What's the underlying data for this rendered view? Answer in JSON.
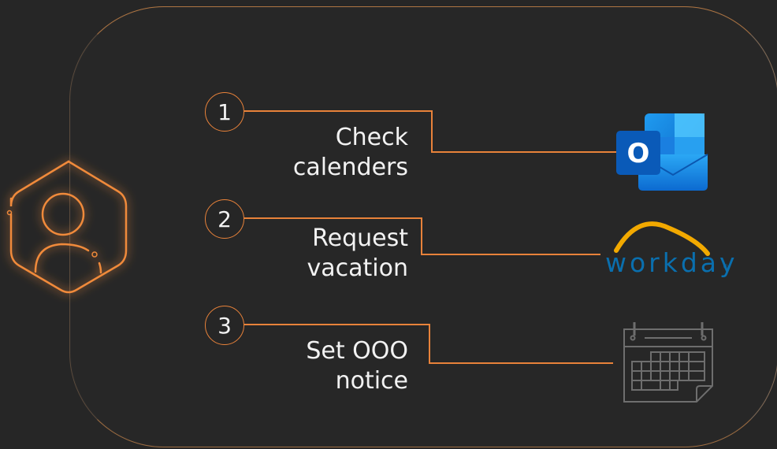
{
  "steps": [
    {
      "number": "1",
      "label_line1": "Check",
      "label_line2": "calenders",
      "app": "outlook-icon"
    },
    {
      "number": "2",
      "label_line1": "Request",
      "label_line2": "vacation",
      "app": "workday-logo"
    },
    {
      "number": "3",
      "label_line1": "Set OOO",
      "label_line2": "notice",
      "app": "calendar-icon"
    }
  ],
  "workday": {
    "wordmark": "workday",
    "mark": "®"
  },
  "outlook": {
    "letter": "O"
  },
  "colors": {
    "background": "#262626",
    "accent_orange": "#e8823a",
    "outlook_blue": "#0a64c8",
    "workday_blue": "#0a6fae",
    "workday_arc": "#f2a900",
    "calendar_gray": "#6e6e6e"
  }
}
